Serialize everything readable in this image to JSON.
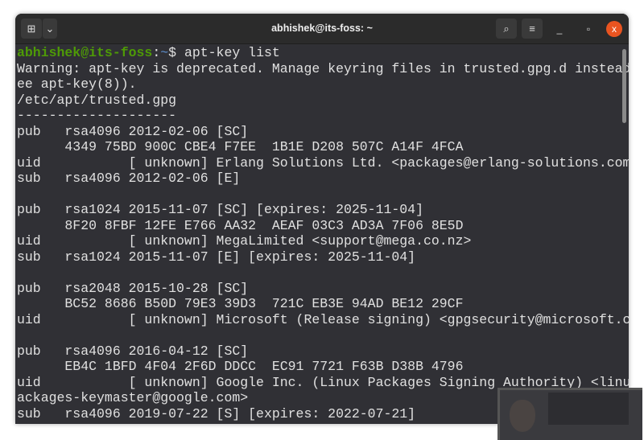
{
  "window": {
    "title": "abhishek@its-foss: ~",
    "new_tab_icon": "new-tab-icon",
    "dropdown_icon": "chevron-down-icon",
    "search_icon": "search-icon",
    "menu_icon": "hamburger-icon",
    "minimize": "_",
    "maximize": "▫",
    "close": "x"
  },
  "prompt": {
    "user": "abhishek@its-foss",
    "sep": ":",
    "path": "~",
    "symbol": "$ ",
    "command": "apt-key list"
  },
  "output": [
    "Warning: apt-key is deprecated. Manage keyring files in trusted.gpg.d instead (s",
    "ee apt-key(8)).",
    "/etc/apt/trusted.gpg",
    "--------------------",
    "pub   rsa4096 2012-02-06 [SC]",
    "      4349 75BD 900C CBE4 F7EE  1B1E D208 507C A14F 4FCA",
    "uid           [ unknown] Erlang Solutions Ltd. <packages@erlang-solutions.com>",
    "sub   rsa4096 2012-02-06 [E]",
    "",
    "pub   rsa1024 2015-11-07 [SC] [expires: 2025-11-04]",
    "      8F20 8FBF 12FE E766 AA32  AEAF 03C3 AD3A 7F06 8E5D",
    "uid           [ unknown] MegaLimited <support@mega.co.nz>",
    "sub   rsa1024 2015-11-07 [E] [expires: 2025-11-04]",
    "",
    "pub   rsa2048 2015-10-28 [SC]",
    "      BC52 8686 B50D 79E3 39D3  721C EB3E 94AD BE12 29CF",
    "uid           [ unknown] Microsoft (Release signing) <gpgsecurity@microsoft.com>",
    "",
    "pub   rsa4096 2016-04-12 [SC]",
    "      EB4C 1BFD 4F04 2F6D DDCC  EC91 7721 F63B D38B 4796",
    "uid           [ unknown] Google Inc. (Linux Packages Signing Authority) <linux-p",
    "ackages-keymaster@google.com>",
    "sub   rsa4096 2019-07-22 [S] [expires: 2022-07-21]"
  ]
}
